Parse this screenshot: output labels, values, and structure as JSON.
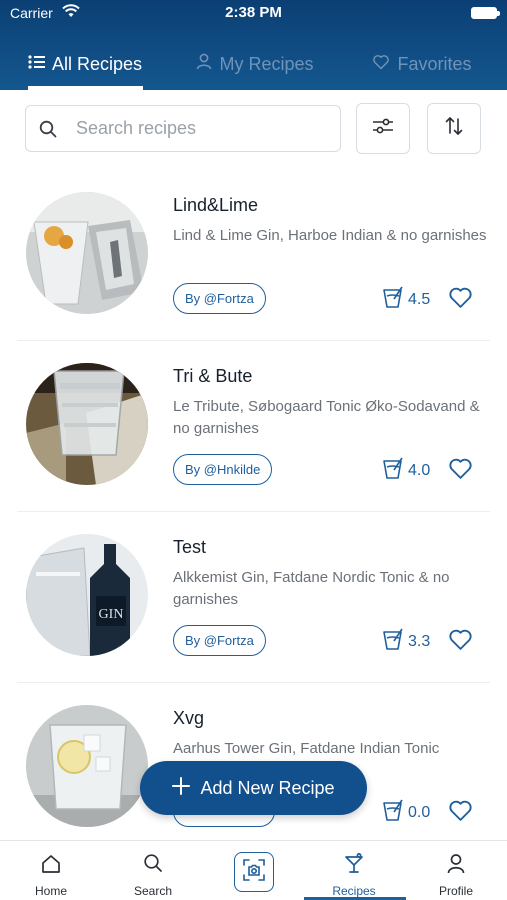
{
  "status_bar": {
    "carrier": "Carrier",
    "time": "2:38 PM"
  },
  "tabs": [
    {
      "label": "All Recipes",
      "icon": "list-icon",
      "active": true
    },
    {
      "label": "My Recipes",
      "icon": "user-icon",
      "active": false
    },
    {
      "label": "Favorites",
      "icon": "heart-icon",
      "active": false
    }
  ],
  "search": {
    "placeholder": "Search recipes",
    "value": ""
  },
  "recipes": [
    {
      "title": "Lind&Lime",
      "description": "Lind & Lime Gin, Harboe Indian & no garnishes",
      "author": "By @Fortza",
      "rating": "4.5"
    },
    {
      "title": "Tri & Bute",
      "description": "Le Tribute, Søbogaard Tonic Øko-Sodavand & no garnishes",
      "author": "By @Hnkilde",
      "rating": "4.0"
    },
    {
      "title": "Test",
      "description": "Alkkemist Gin, Fatdane Nordic Tonic & no garnishes",
      "author": "By @Fortza",
      "rating": "3.3"
    },
    {
      "title": "Xvg",
      "description": "Aarhus Tower Gin, Fatdane Indian Tonic",
      "author": "",
      "rating": "0.0"
    }
  ],
  "fab": {
    "label": "Add New Recipe"
  },
  "bottom_nav": [
    {
      "label": "Home",
      "icon": "home-icon"
    },
    {
      "label": "Search",
      "icon": "search-icon"
    },
    {
      "label": "",
      "icon": "camera-scan-icon"
    },
    {
      "label": "Recipes",
      "icon": "cocktail-glass-icon",
      "active": true
    },
    {
      "label": "Profile",
      "icon": "profile-icon"
    }
  ],
  "colors": {
    "header": "#0b3f74",
    "accent": "#1f5f9c",
    "fab": "#11508d"
  }
}
